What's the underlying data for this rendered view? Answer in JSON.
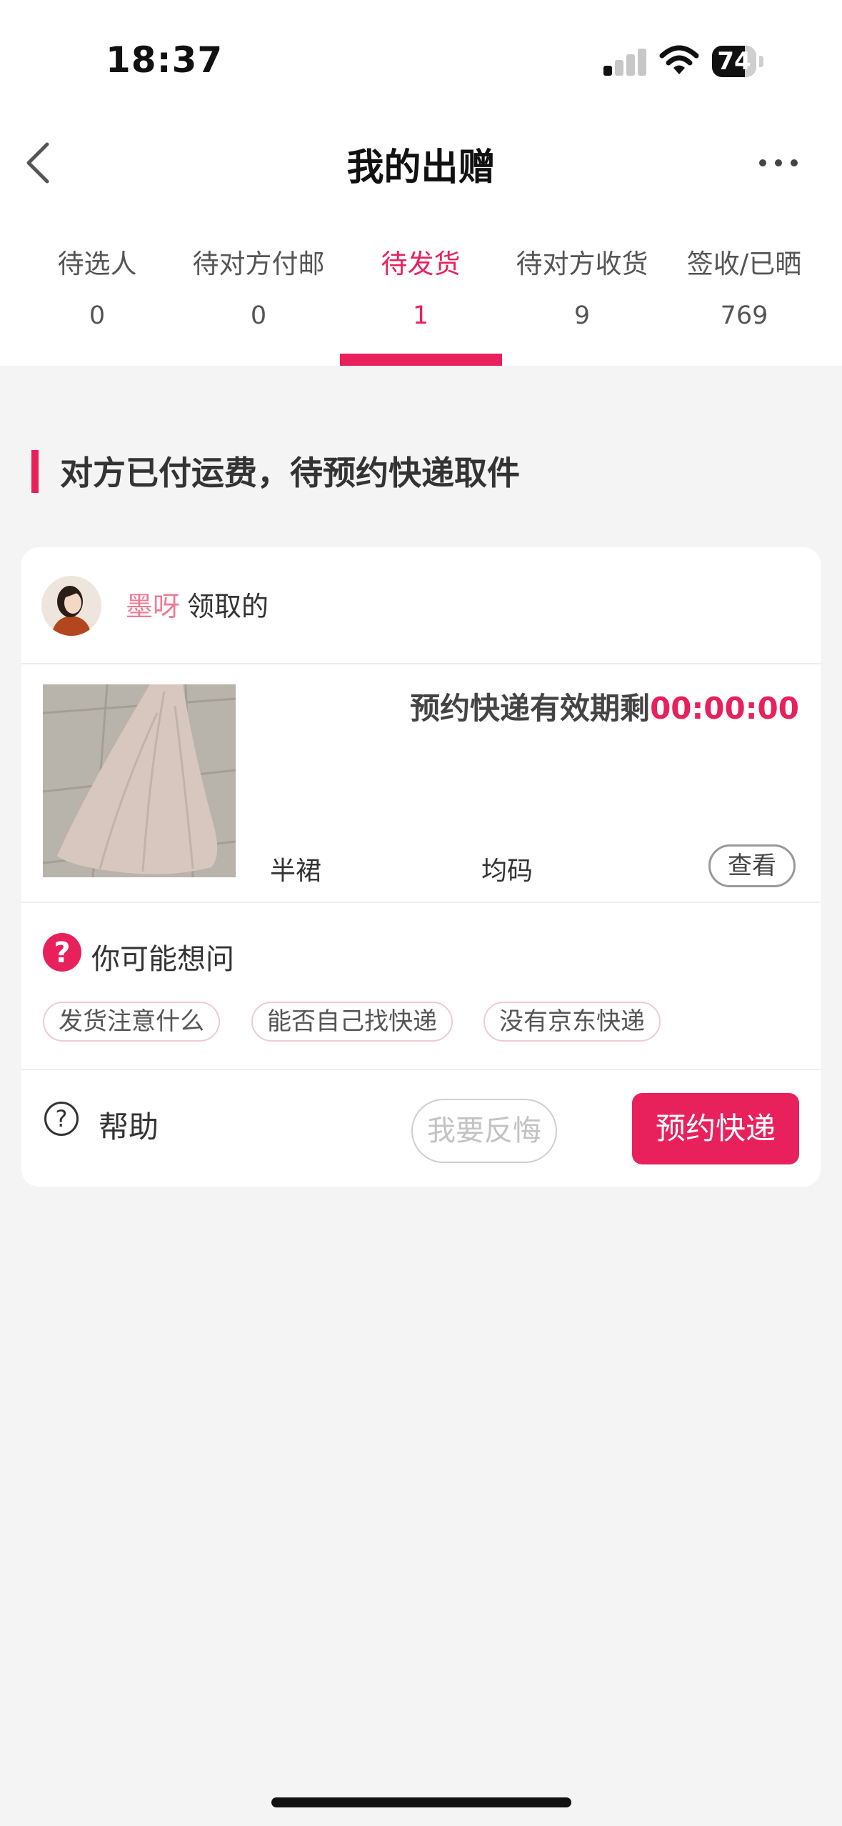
{
  "status_bar": {
    "time": "18:37",
    "battery": "74",
    "battery_level": 0.74,
    "signal_bars_active": 1,
    "signal_bars_total": 4
  },
  "nav": {
    "title": "我的出赠"
  },
  "tabs": [
    {
      "label": "待选人",
      "count": "0"
    },
    {
      "label": "待对方付邮",
      "count": "0"
    },
    {
      "label": "待发货",
      "count": "1"
    },
    {
      "label": "待对方收货",
      "count": "9"
    },
    {
      "label": "签收/已晒",
      "count": "769"
    }
  ],
  "active_tab": 2,
  "section": {
    "title": "对方已付运费，待预约快递取件"
  },
  "order": {
    "claimer_name": "墨呀",
    "claimer_suffix": "领取的",
    "deadline_label": "预约快递有效期剩",
    "deadline_time": "00:00:00",
    "product_name": "半裙",
    "product_size": "均码",
    "view_label": "查看"
  },
  "faq": {
    "title": "你可能想问",
    "chips": [
      "发货注意什么",
      "能否自己找快递",
      "没有京东快递"
    ]
  },
  "actions": {
    "help_label": "帮助",
    "regret_label": "我要反悔",
    "book_label": "预约快递"
  },
  "colors": {
    "accent": "#e8215c",
    "nickname": "#ef7a94",
    "background": "#f4f4f4"
  }
}
